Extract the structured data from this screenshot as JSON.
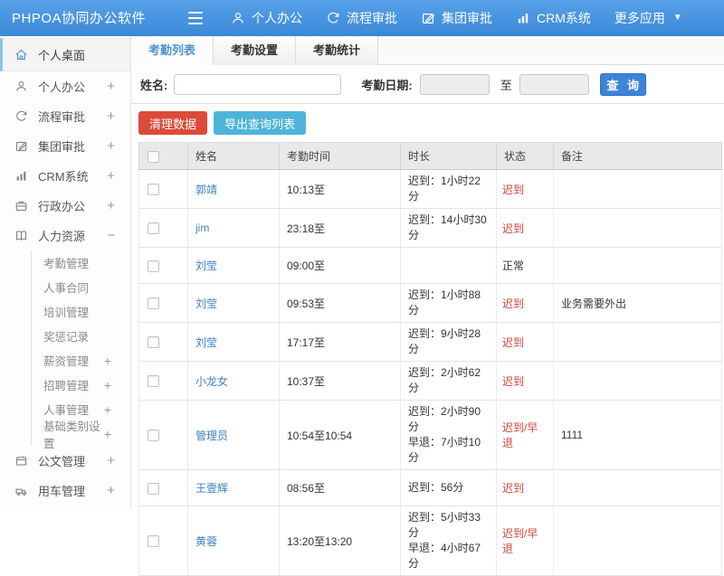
{
  "app": {
    "brand": "PHPOA协同办公软件"
  },
  "colors": {
    "header_blue_top": "#57a1e9",
    "header_blue_bottom": "#3d89d8",
    "accent_blue": "#3c84d8",
    "danger_red": "#dc4a3a",
    "export_teal": "#4eb4da",
    "link_blue": "#3f80c0",
    "status_red": "#cf4339",
    "active_tab_blue": "#4f93cf"
  },
  "header_nav": [
    {
      "name": "personal-office",
      "icon": "user-icon",
      "label": "个人办公"
    },
    {
      "name": "workflow-approval",
      "icon": "flow-icon",
      "label": "流程审批"
    },
    {
      "name": "group-approval",
      "icon": "edit-icon",
      "label": "集团审批"
    },
    {
      "name": "crm-system",
      "icon": "chart-icon",
      "label": "CRM系统"
    },
    {
      "name": "more-apps",
      "icon": "caret-down-icon",
      "label": "更多应用",
      "caret": "▼"
    }
  ],
  "sidebar": {
    "items": [
      {
        "name": "personal-desktop",
        "icon": "home-icon",
        "label": "个人桌面",
        "active": true
      },
      {
        "name": "personal-office",
        "icon": "user-icon",
        "label": "个人办公",
        "expander": "+"
      },
      {
        "name": "workflow-approval",
        "icon": "flow-icon",
        "label": "流程审批",
        "expander": "+"
      },
      {
        "name": "group-approval",
        "icon": "edit-icon",
        "label": "集团审批",
        "expander": "+"
      },
      {
        "name": "crm-system",
        "icon": "chart-icon",
        "label": "CRM系统",
        "expander": "+"
      },
      {
        "name": "admin-office",
        "icon": "briefcase-icon",
        "label": "行政办公",
        "expander": "+"
      },
      {
        "name": "human-resources",
        "icon": "book-icon",
        "label": "人力资源",
        "expander": "−",
        "children": [
          {
            "name": "attendance-mgmt",
            "label": "考勤管理"
          },
          {
            "name": "hr-contract",
            "label": "人事合同"
          },
          {
            "name": "training-mgmt",
            "label": "培训管理"
          },
          {
            "name": "reward-punishment",
            "label": "奖惩记录"
          },
          {
            "name": "salary-mgmt",
            "label": "薪资管理",
            "expander": "+"
          },
          {
            "name": "recruitment-mgmt",
            "label": "招聘管理",
            "expander": "+"
          },
          {
            "name": "personnel-mgmt",
            "label": "人事管理",
            "expander": "+"
          },
          {
            "name": "base-category-settings",
            "label": "基础类别设置",
            "expander": "+"
          }
        ]
      },
      {
        "name": "document-mgmt",
        "icon": "doc-icon",
        "label": "公文管理",
        "expander": "+"
      },
      {
        "name": "vehicle-mgmt",
        "icon": "car-icon",
        "label": "用车管理",
        "expander": "+"
      }
    ]
  },
  "tabs": [
    {
      "name": "attendance-list",
      "label": "考勤列表",
      "active": true
    },
    {
      "name": "attendance-settings",
      "label": "考勤设置",
      "active": false
    },
    {
      "name": "attendance-stats",
      "label": "考勤统计",
      "active": false
    }
  ],
  "filters": {
    "name_label": "姓名:",
    "name_value": "",
    "date_label": "考勤日期:",
    "date_from_value": "",
    "to_label": "至",
    "date_to_value": "",
    "search_button": "查 询"
  },
  "actions": {
    "clean_button": "清理数据",
    "export_button": "导出查询列表"
  },
  "table": {
    "columns": [
      "姓名",
      "考勤时间",
      "时长",
      "状态",
      "备注"
    ],
    "rows": [
      {
        "name": "郭靖",
        "time": "10:13至",
        "duration": [
          "迟到：1小时22分"
        ],
        "status": "迟到",
        "status_type": "red",
        "remark": ""
      },
      {
        "name": "jim",
        "time": "23:18至",
        "duration": [
          "迟到：14小时30分"
        ],
        "status": "迟到",
        "status_type": "red",
        "remark": ""
      },
      {
        "name": "刘莹",
        "time": "09:00至",
        "duration": [],
        "status": "正常",
        "status_type": "normal",
        "remark": ""
      },
      {
        "name": "刘莹",
        "time": "09:53至",
        "duration": [
          "迟到：1小时88分"
        ],
        "status": "迟到",
        "status_type": "red",
        "remark": "业务需要外出"
      },
      {
        "name": "刘莹",
        "time": "17:17至",
        "duration": [
          "迟到：9小时28分"
        ],
        "status": "迟到",
        "status_type": "red",
        "remark": ""
      },
      {
        "name": "小龙女",
        "time": "10:37至",
        "duration": [
          "迟到：2小时62分"
        ],
        "status": "迟到",
        "status_type": "red",
        "remark": ""
      },
      {
        "name": "管理员",
        "time": "10:54至10:54",
        "duration": [
          "迟到：2小时90分",
          "早退：7小时10分"
        ],
        "status": "迟到/早退",
        "status_type": "red",
        "remark": "1111"
      },
      {
        "name": "王壹辉",
        "time": "08:56至",
        "duration": [
          "迟到：56分"
        ],
        "status": "迟到",
        "status_type": "red",
        "remark": ""
      },
      {
        "name": "黄蓉",
        "time": "13:20至13:20",
        "duration": [
          "迟到：5小时33分",
          "早退：4小时67分"
        ],
        "status": "迟到/早退",
        "status_type": "red",
        "remark": ""
      }
    ]
  }
}
